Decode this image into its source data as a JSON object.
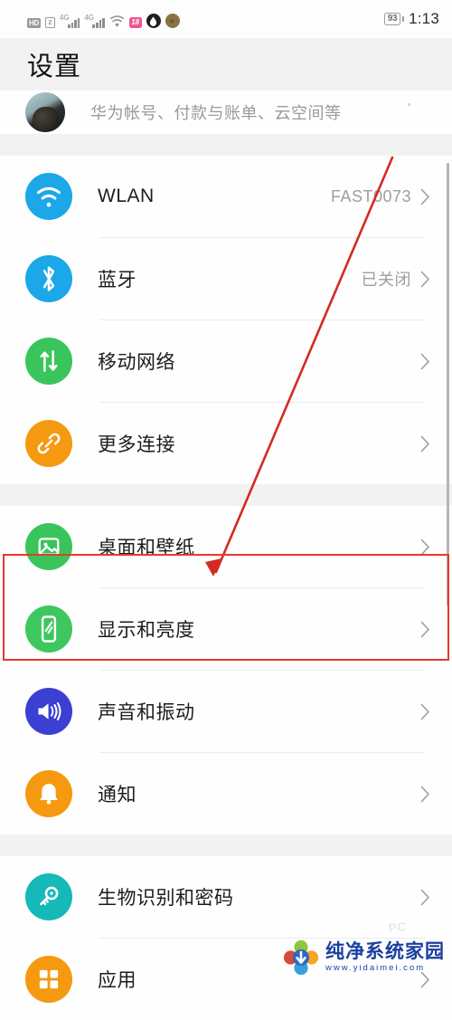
{
  "status_bar": {
    "hd_label": "HD",
    "sim_label": "2",
    "network_1": "4G",
    "network_2": "4G",
    "wifi_icon": "wifi-icon",
    "pink_badge_label": "18",
    "drop_icon": "water-drop-icon",
    "gold_icon": "coin-icon",
    "battery_level": "93",
    "time": "1:13"
  },
  "header": {
    "title": "设置"
  },
  "account_row": {
    "avatar": "user-avatar",
    "subtitle": "华为帐号、付款与账单、云空间等"
  },
  "sections": [
    {
      "rows": [
        {
          "icon": "wifi-icon",
          "icon_color": "#1ba7e8",
          "label": "WLAN",
          "value": "FAST0073",
          "chevron": true
        },
        {
          "icon": "bluetooth-icon",
          "icon_color": "#1ba7e8",
          "label": "蓝牙",
          "value": "已关闭",
          "chevron": true
        },
        {
          "icon": "mobile-data-icon",
          "icon_color": "#39c55b",
          "label": "移动网络",
          "value": "",
          "chevron": true
        },
        {
          "icon": "link-icon",
          "icon_color": "#f59a10",
          "label": "更多连接",
          "value": "",
          "chevron": true
        }
      ]
    },
    {
      "rows": [
        {
          "icon": "image-icon",
          "icon_color": "#39c55b",
          "label": "桌面和壁纸",
          "value": "",
          "chevron": true
        },
        {
          "icon": "brightness-icon",
          "icon_color": "#3ec75e",
          "label": "显示和亮度",
          "value": "",
          "chevron": true
        },
        {
          "icon": "speaker-icon",
          "icon_color": "#3b3fd2",
          "label": "声音和振动",
          "value": "",
          "chevron": true
        },
        {
          "icon": "bell-icon",
          "icon_color": "#f59a10",
          "label": "通知",
          "value": "",
          "chevron": true
        }
      ]
    },
    {
      "rows": [
        {
          "icon": "key-icon",
          "icon_color": "#16b8b8",
          "label": "生物识别和密码",
          "value": "",
          "chevron": true
        },
        {
          "icon": "apps-icon",
          "icon_color": "#f59a10",
          "label": "应用",
          "value": "",
          "chevron": true
        }
      ]
    }
  ],
  "annotation": {
    "highlight_color": "#e8382e",
    "highlight_target": "显示和亮度",
    "arrow_color": "#d42a22"
  },
  "watermark": {
    "brand": "纯净系统家园",
    "url": "www.yidaimei.com",
    "ghost_text": "PC"
  }
}
